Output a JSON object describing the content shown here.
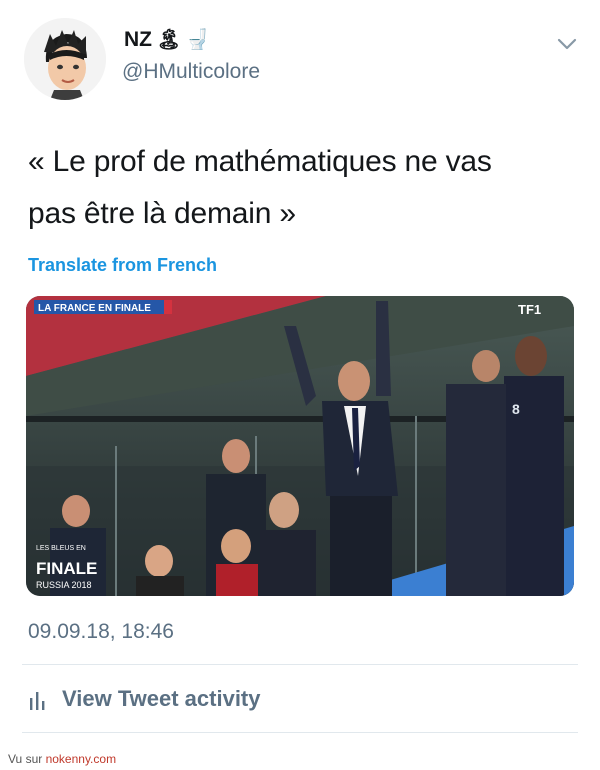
{
  "header": {
    "display_name": "NZ",
    "name_emojis": [
      "🏝",
      "🚽"
    ],
    "handle": "@HMulticolore"
  },
  "tweet": {
    "text_line1": "« Le prof de mathématiques ne vas",
    "text_line2": "pas être là demain »",
    "translate_label": "Translate from French",
    "timestamp": "09.09.18, 18:46"
  },
  "media": {
    "banner_top": "LA FRANCE EN FINALE",
    "channel_logo": "TF1",
    "overlay_small": "LES BLEUS EN",
    "overlay_big": "FINALE",
    "overlay_sub": "RUSSIA 2018",
    "jersey_number": "8"
  },
  "actions": {
    "activity_label": "View Tweet activity",
    "icons": [
      "avatar-cartoon",
      "chevron-down-icon",
      "bar-chart-icon"
    ]
  },
  "footer": {
    "prefix": "Vu sur ",
    "site": "nokenny.com"
  },
  "colors": {
    "link": "#1b95e0",
    "muted": "#5b7083",
    "text": "#14171a",
    "divider": "#e1e8ed"
  }
}
